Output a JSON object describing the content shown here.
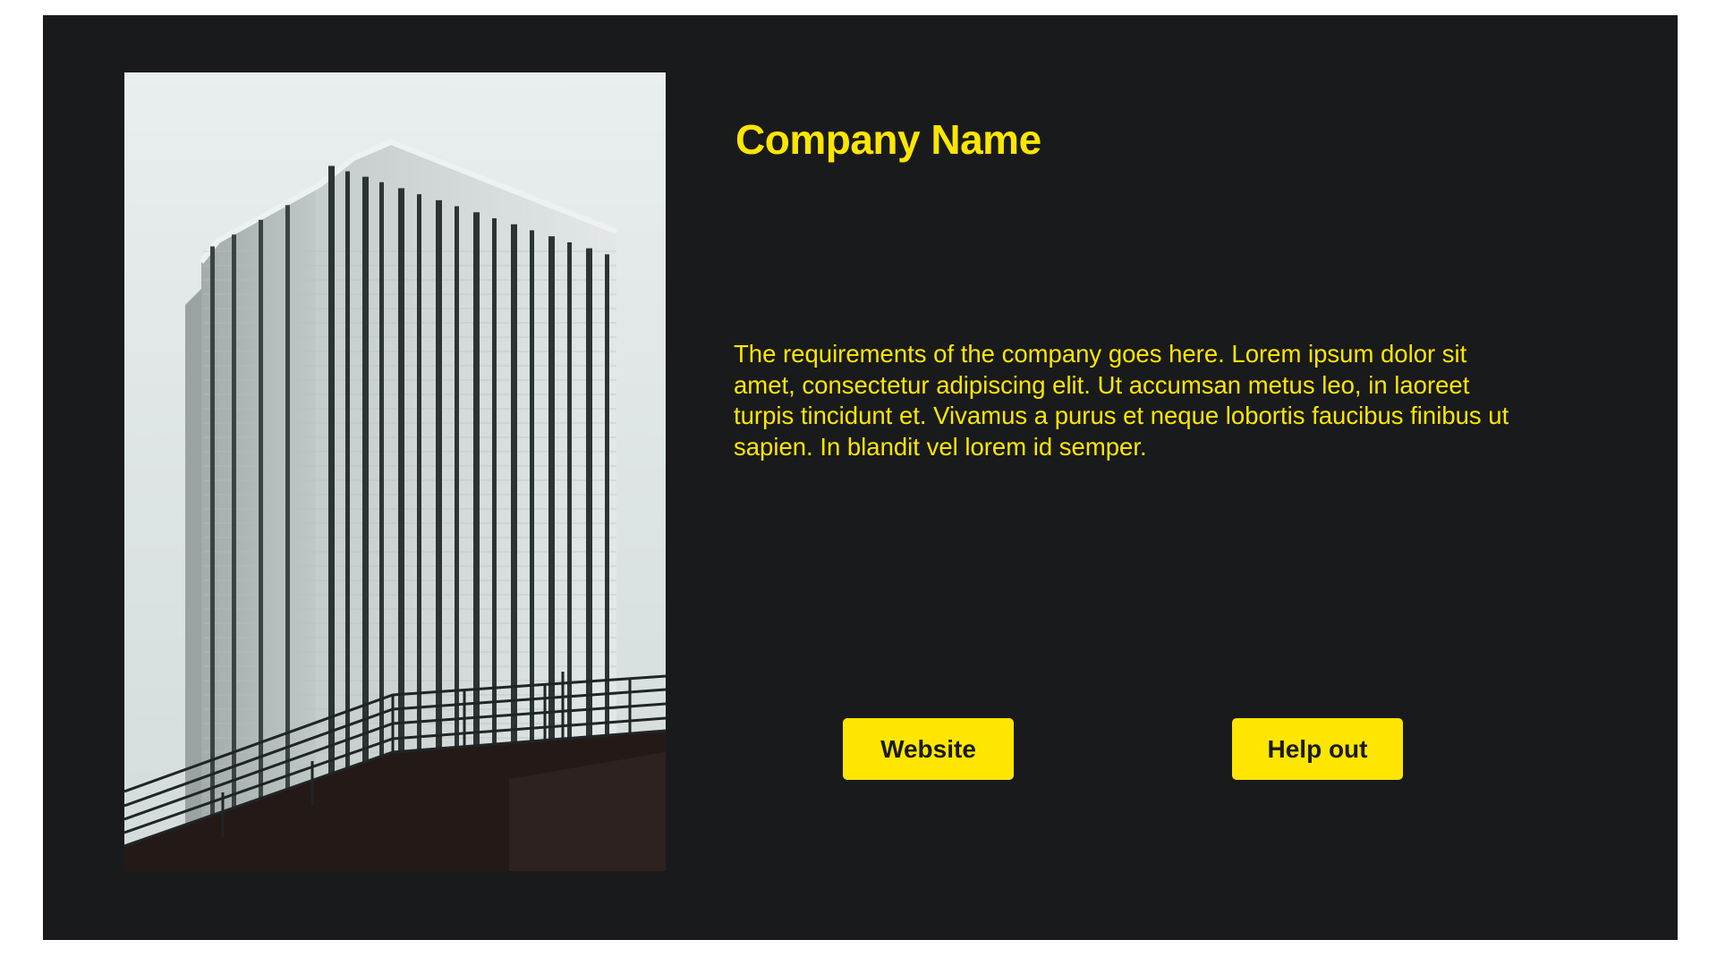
{
  "card": {
    "image": {
      "icon": "skyscraper-photo",
      "subject": "glass office tower with railing in foreground"
    },
    "title": "Company Name",
    "description": "The requirements of the company goes here. Lorem ipsum dolor sit amet, consectetur adipiscing elit. Ut accumsan metus leo, in laoreet turpis tincidunt et. Vivamus a purus et neque lobortis faucibus finibus ut sapien. In blandit vel lorem id semper.",
    "buttons": {
      "website_label": "Website",
      "help_label": "Help out"
    }
  },
  "colors": {
    "background": "#181a1b",
    "accent": "#ffe600",
    "button_text": "#181a1b"
  }
}
